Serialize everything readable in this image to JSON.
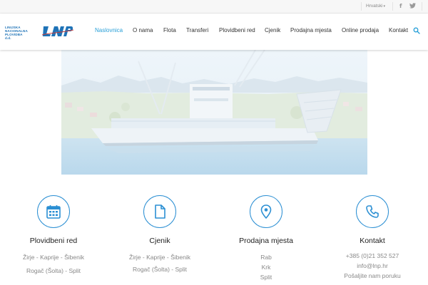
{
  "topbar": {
    "language": "Hrvatski",
    "social": [
      "f",
      "t"
    ]
  },
  "logo": {
    "line1": "LINIJSKA",
    "line2": "NACIONALNA",
    "line3": "PLOVIDBA d.d.",
    "mark": "LNP"
  },
  "nav": {
    "items": [
      "Naslovnica",
      "O nama",
      "Flota",
      "Transferi",
      "Plovidbeni red",
      "Cjenik",
      "Prodajna mjesta",
      "Online prodaja",
      "Kontakt"
    ],
    "active": "Naslovnica"
  },
  "colors": {
    "accent": "#29a0d8",
    "icon": "#2b8fd3",
    "muted_text": "#888888"
  },
  "features": [
    {
      "icon": "calendar-icon",
      "title": "Plovidbeni red",
      "lines": [
        "Žirje - Kaprije - Šibenik",
        "Rogač (Šolta) - Split"
      ]
    },
    {
      "icon": "document-icon",
      "title": "Cjenik",
      "lines": [
        "Žirje - Kaprije - Šibenik",
        "Rogač (Šolta) - Split"
      ]
    },
    {
      "icon": "map-pin-icon",
      "title": "Prodajna mjesta",
      "lines": [
        "Rab",
        "Krk",
        "Split"
      ]
    },
    {
      "icon": "phone-icon",
      "title": "Kontakt",
      "lines": [
        "+385 (0)21 352 527",
        "info@lnp.hr",
        "Pošaljite nam poruku"
      ]
    }
  ]
}
